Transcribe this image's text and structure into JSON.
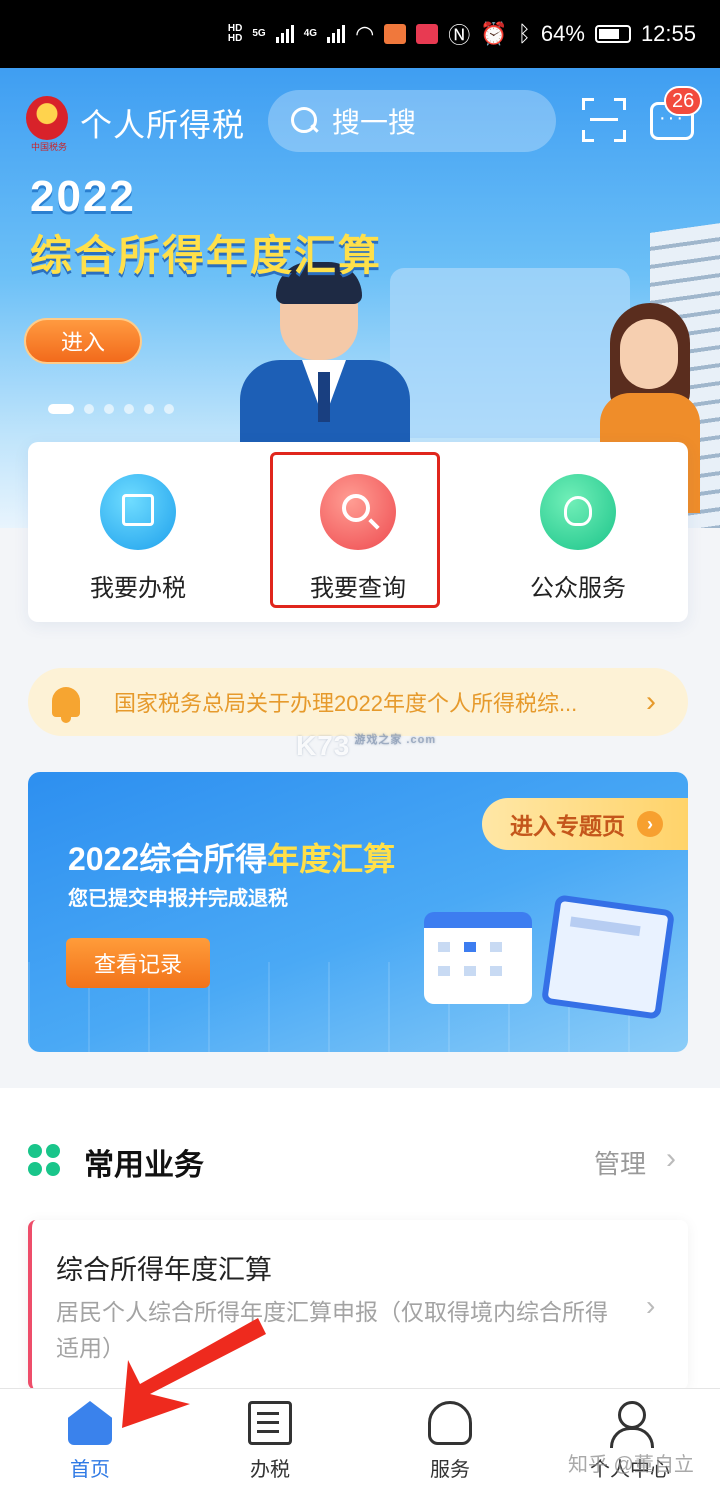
{
  "status_bar": {
    "hd1": "HD",
    "hd2": "HD",
    "net1": "5G",
    "net2": "4G",
    "battery": "64%",
    "time": "12:55"
  },
  "header": {
    "app_title": "个人所得税",
    "search_placeholder": "搜一搜",
    "message_badge": "26",
    "emblem_caption": "中国税务"
  },
  "banner": {
    "year": "2022",
    "title": "综合所得年度汇算",
    "enter_label": "进入"
  },
  "quick_actions": [
    {
      "label": "我要办税",
      "icon": "edit-icon"
    },
    {
      "label": "我要查询",
      "icon": "search-icon"
    },
    {
      "label": "公众服务",
      "icon": "lotus-icon"
    }
  ],
  "notice": {
    "text": "国家税务总局关于办理2022年度个人所得税综..."
  },
  "watermark": "K73",
  "watermark_sub": "游戏之家 .com",
  "promo": {
    "tag": "进入专题页",
    "title_prefix": "2022综合所得",
    "title_highlight": "年度汇算",
    "subtitle": "您已提交申报并完成退税",
    "button": "查看记录"
  },
  "common_services": {
    "title": "常用业务",
    "manage": "管理",
    "card_title": "综合所得年度汇算",
    "card_desc": "居民个人综合所得年度汇算申报（仅取得境内综合所得适用）"
  },
  "tabs": [
    {
      "label": "首页",
      "icon": "home-icon"
    },
    {
      "label": "办税",
      "icon": "document-icon"
    },
    {
      "label": "服务",
      "icon": "heart-hand-icon"
    },
    {
      "label": "个人中心",
      "icon": "user-icon"
    }
  ],
  "source_watermark": "知乎 @董自立",
  "colors": {
    "accent": "#2f7ae5",
    "highlight_border": "#e0261d",
    "arrow": "#ee2a1e"
  }
}
